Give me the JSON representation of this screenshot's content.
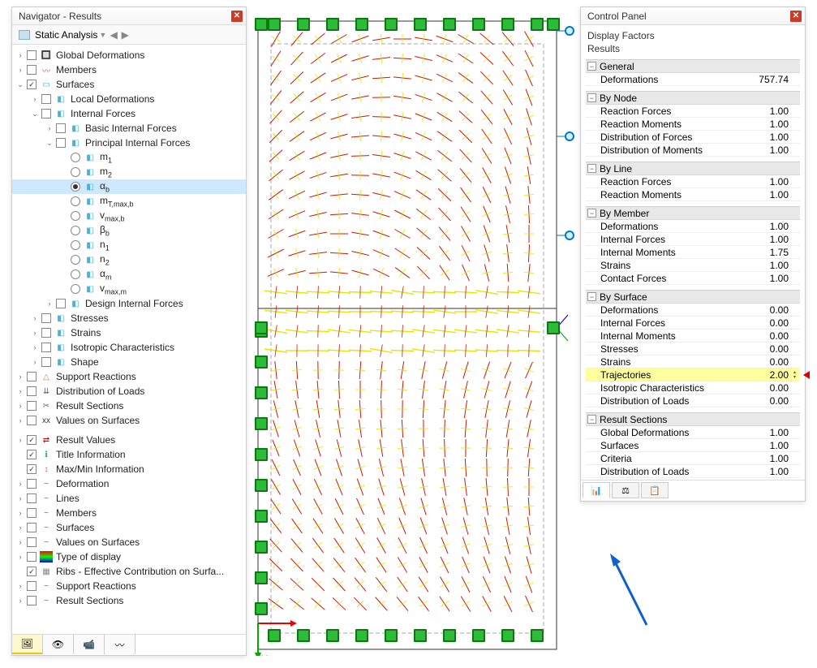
{
  "navigator": {
    "title": "Navigator - Results",
    "dropdown": "Static Analysis",
    "tree": [
      {
        "d": 0,
        "exp": ">",
        "cb": "",
        "ic": "🔲",
        "lbl": "Global Deformations"
      },
      {
        "d": 0,
        "exp": ">",
        "cb": "",
        "ic": "〰",
        "lbl": "Members",
        "iconColor": "#d04a8a"
      },
      {
        "d": 0,
        "exp": "v",
        "cb": "✓",
        "ic": "▭",
        "lbl": "Surfaces",
        "iconColor": "#46b1e1"
      },
      {
        "d": 1,
        "exp": ">",
        "cb": "",
        "ic": "◧",
        "lbl": "Local Deformations",
        "iconColor": "#46b1e1"
      },
      {
        "d": 1,
        "exp": "v",
        "cb": "",
        "ic": "◧",
        "lbl": "Internal Forces",
        "iconColor": "#46b1e1"
      },
      {
        "d": 2,
        "exp": ">",
        "cb": "",
        "ic": "◧",
        "lbl": "Basic Internal Forces",
        "iconColor": "#46b1e1"
      },
      {
        "d": 2,
        "exp": "v",
        "cb": "",
        "ic": "◧",
        "lbl": "Principal Internal Forces",
        "iconColor": "#46b1e1"
      },
      {
        "d": 3,
        "radio": "",
        "ic": "◧",
        "lbl": "m<sub>1</sub>",
        "iconColor": "#46b1e1"
      },
      {
        "d": 3,
        "radio": "",
        "ic": "◧",
        "lbl": "m<sub>2</sub>",
        "iconColor": "#46b1e1"
      },
      {
        "d": 3,
        "radio": "on",
        "ic": "◧",
        "lbl": "α<sub>b</sub>",
        "iconColor": "#46b1e1",
        "selected": true
      },
      {
        "d": 3,
        "radio": "",
        "ic": "◧",
        "lbl": "m<sub>T,max,b</sub>",
        "iconColor": "#46b1e1"
      },
      {
        "d": 3,
        "radio": "",
        "ic": "◧",
        "lbl": "v<sub>max,b</sub>",
        "iconColor": "#46b1e1"
      },
      {
        "d": 3,
        "radio": "",
        "ic": "◧",
        "lbl": "β<sub>b</sub>",
        "iconColor": "#46b1e1"
      },
      {
        "d": 3,
        "radio": "",
        "ic": "◧",
        "lbl": "n<sub>1</sub>",
        "iconColor": "#46b1e1"
      },
      {
        "d": 3,
        "radio": "",
        "ic": "◧",
        "lbl": "n<sub>2</sub>",
        "iconColor": "#46b1e1"
      },
      {
        "d": 3,
        "radio": "",
        "ic": "◧",
        "lbl": "α<sub>m</sub>",
        "iconColor": "#46b1e1"
      },
      {
        "d": 3,
        "radio": "",
        "ic": "◧",
        "lbl": "v<sub>max,m</sub>",
        "iconColor": "#46b1e1"
      },
      {
        "d": 2,
        "exp": ">",
        "cb": "",
        "ic": "◧",
        "lbl": "Design Internal Forces",
        "iconColor": "#46b1e1"
      },
      {
        "d": 1,
        "exp": ">",
        "cb": "",
        "ic": "◧",
        "lbl": "Stresses",
        "iconColor": "#46b1e1"
      },
      {
        "d": 1,
        "exp": ">",
        "cb": "",
        "ic": "◧",
        "lbl": "Strains",
        "iconColor": "#46b1e1"
      },
      {
        "d": 1,
        "exp": ">",
        "cb": "",
        "ic": "◧",
        "lbl": "Isotropic Characteristics",
        "iconColor": "#46b1e1"
      },
      {
        "d": 1,
        "exp": ">",
        "cb": "",
        "ic": "◧",
        "lbl": "Shape",
        "iconColor": "#46b1e1"
      },
      {
        "d": 0,
        "exp": ">",
        "cb": "",
        "ic": "△",
        "lbl": "Support Reactions",
        "iconColor": "#e08030"
      },
      {
        "d": 0,
        "exp": ">",
        "cb": "",
        "ic": "⇊",
        "lbl": "Distribution of Loads",
        "iconColor": "#666"
      },
      {
        "d": 0,
        "exp": ">",
        "cb": "",
        "ic": "✂",
        "lbl": "Result Sections",
        "iconColor": "#666"
      },
      {
        "d": 0,
        "exp": ">",
        "cb": "",
        "ic": "xx",
        "lbl": "Values on Surfaces",
        "iconColor": "#333"
      },
      {
        "sep": true
      },
      {
        "d": 0,
        "exp": ">",
        "cb": "✓",
        "ic": "⇄",
        "lbl": "Result Values",
        "iconColor": "#c00"
      },
      {
        "d": 0,
        "cb": "✓",
        "ic": "ℹ",
        "lbl": "Title Information",
        "iconColor": "#3a6"
      },
      {
        "d": 0,
        "cb": "✓",
        "ic": "↕",
        "lbl": "Max/Min Information",
        "iconColor": "#c55"
      },
      {
        "d": 0,
        "exp": ">",
        "cb": "",
        "ic": "~",
        "lbl": "Deformation",
        "iconColor": "#2a78c0"
      },
      {
        "d": 0,
        "exp": ">",
        "cb": "",
        "ic": "~",
        "lbl": "Lines",
        "iconColor": "#2a78c0"
      },
      {
        "d": 0,
        "exp": ">",
        "cb": "",
        "ic": "~",
        "lbl": "Members",
        "iconColor": "#2a78c0"
      },
      {
        "d": 0,
        "exp": ">",
        "cb": "",
        "ic": "~",
        "lbl": "Surfaces",
        "iconColor": "#2a78c0"
      },
      {
        "d": 0,
        "exp": ">",
        "cb": "",
        "ic": "~",
        "lbl": "Values on Surfaces",
        "iconColor": "#2a78c0"
      },
      {
        "d": 0,
        "exp": ">",
        "cb": "",
        "ic": "▥",
        "lbl": "Type of display",
        "iconColor": "linear-gradient(#f00,#0f0,#00f)"
      },
      {
        "d": 0,
        "cb": "✓",
        "ic": "▦",
        "lbl": "Ribs - Effective Contribution on Surfa...",
        "iconColor": "#888"
      },
      {
        "d": 0,
        "exp": ">",
        "cb": "",
        "ic": "~",
        "lbl": "Support Reactions",
        "iconColor": "#2a78c0"
      },
      {
        "d": 0,
        "exp": ">",
        "cb": "",
        "ic": "~",
        "lbl": "Result Sections",
        "iconColor": "#2a78c0"
      }
    ],
    "footerIcons": [
      "🖼",
      "👁",
      "📹",
      "〰"
    ]
  },
  "controlPanel": {
    "title": "Control Panel",
    "subtitle1": "Display Factors",
    "subtitle2": "Results",
    "sections": [
      {
        "name": "General",
        "rows": [
          {
            "n": "Deformations",
            "v": "757.74"
          }
        ]
      },
      {
        "name": "By Node",
        "rows": [
          {
            "n": "Reaction Forces",
            "v": "1.00"
          },
          {
            "n": "Reaction Moments",
            "v": "1.00"
          },
          {
            "n": "Distribution of Forces",
            "v": "1.00"
          },
          {
            "n": "Distribution of Moments",
            "v": "1.00"
          }
        ]
      },
      {
        "name": "By Line",
        "rows": [
          {
            "n": "Reaction Forces",
            "v": "1.00"
          },
          {
            "n": "Reaction Moments",
            "v": "1.00"
          }
        ]
      },
      {
        "name": "By Member",
        "rows": [
          {
            "n": "Deformations",
            "v": "1.00"
          },
          {
            "n": "Internal Forces",
            "v": "1.00"
          },
          {
            "n": "Internal Moments",
            "v": "1.75"
          },
          {
            "n": "Strains",
            "v": "1.00"
          },
          {
            "n": "Contact Forces",
            "v": "1.00"
          }
        ]
      },
      {
        "name": "By Surface",
        "rows": [
          {
            "n": "Deformations",
            "v": "0.00"
          },
          {
            "n": "Internal Forces",
            "v": "0.00"
          },
          {
            "n": "Internal Moments",
            "v": "0.00"
          },
          {
            "n": "Stresses",
            "v": "0.00"
          },
          {
            "n": "Strains",
            "v": "0.00"
          },
          {
            "n": "Trajectories",
            "v": "2.00",
            "hl": true
          },
          {
            "n": "Isotropic Characteristics",
            "v": "0.00"
          },
          {
            "n": "Distribution of Loads",
            "v": "0.00"
          }
        ]
      },
      {
        "name": "Result Sections",
        "rows": [
          {
            "n": "Global Deformations",
            "v": "1.00"
          },
          {
            "n": "Surfaces",
            "v": "1.00"
          },
          {
            "n": "Criteria",
            "v": "1.00"
          },
          {
            "n": "Distribution of Loads",
            "v": "1.00"
          }
        ]
      }
    ],
    "tabs": [
      "📊",
      "⚖",
      "📋"
    ]
  }
}
